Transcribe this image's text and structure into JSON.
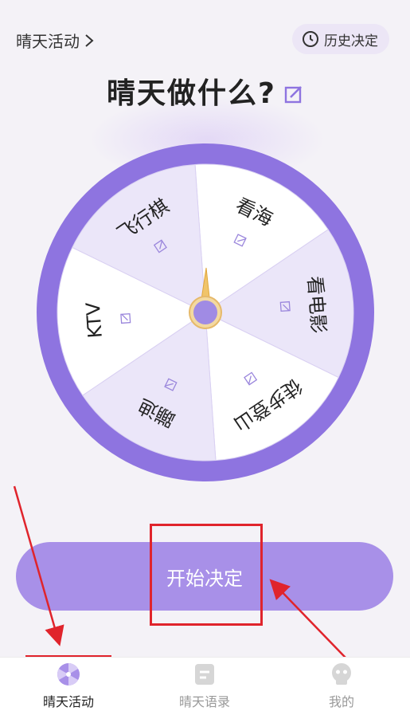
{
  "header": {
    "activity_link": "晴天活动",
    "history_button": "历史决定",
    "title": "晴天做什么?"
  },
  "wheel": {
    "segments": [
      {
        "label": "看海"
      },
      {
        "label": "看电影"
      },
      {
        "label": "徒步登山"
      },
      {
        "label": "蹦迪"
      },
      {
        "label": "KTV"
      },
      {
        "label": "飞行棋"
      }
    ]
  },
  "start_button": {
    "label": "开始决定"
  },
  "tabbar": {
    "items": [
      {
        "label": "晴天活动",
        "icon": "wheel-icon"
      },
      {
        "label": "晴天语录",
        "icon": "note-icon"
      },
      {
        "label": "我的",
        "icon": "profile-icon"
      }
    ]
  },
  "colors": {
    "accent": "#a890e8",
    "wheel_rim": "#8e74e0",
    "segment_light": "#ffffff",
    "segment_tint": "#ebe6f9",
    "annotation": "#e0242c"
  }
}
